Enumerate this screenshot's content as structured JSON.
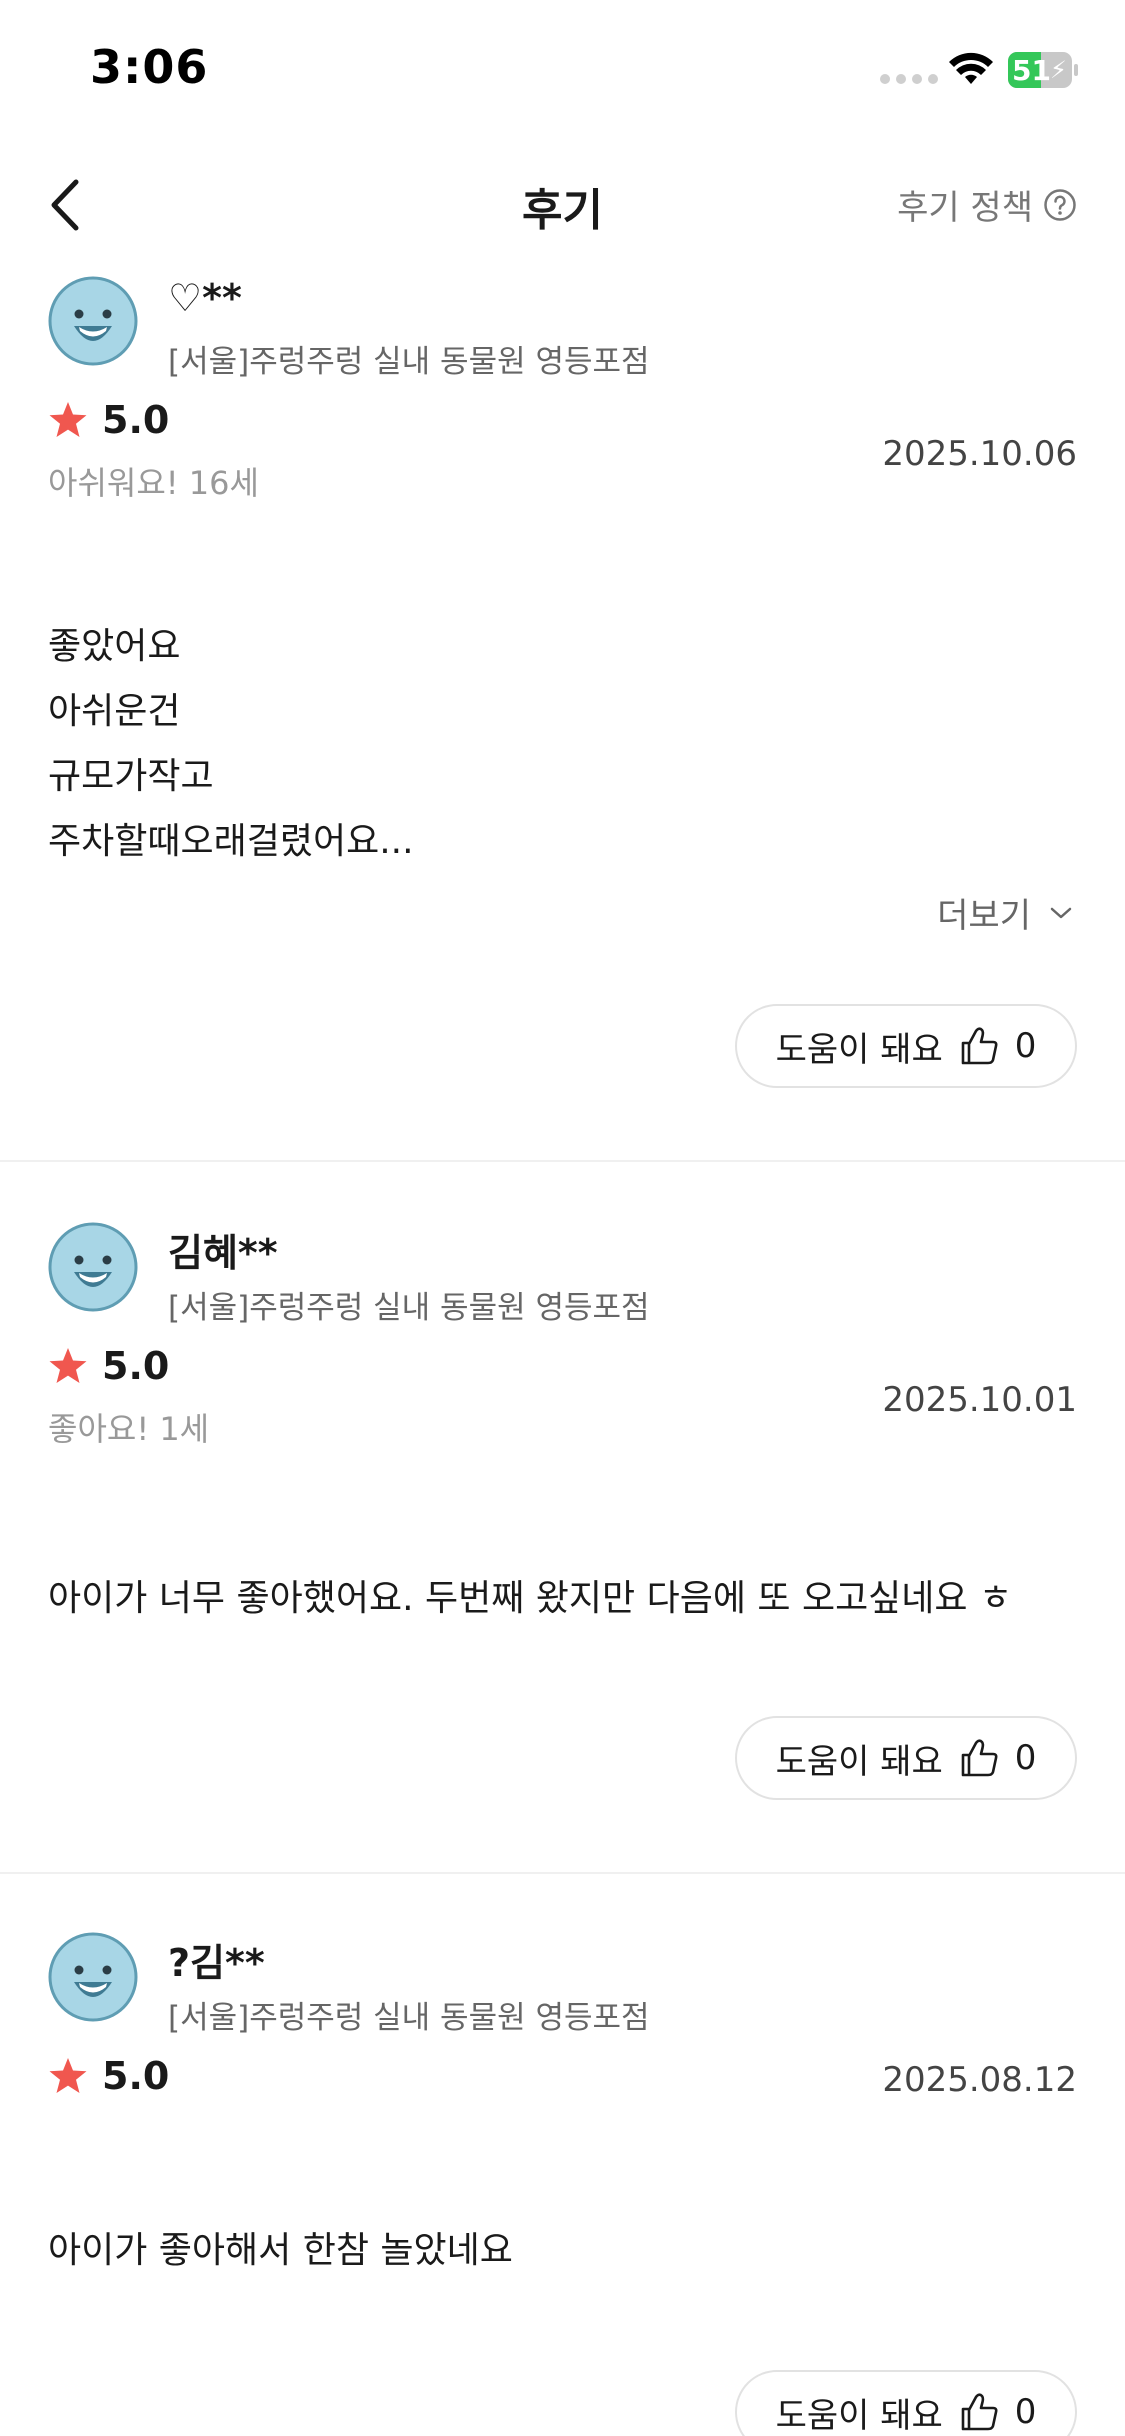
{
  "status_bar": {
    "time": "3:06",
    "battery": "51"
  },
  "nav": {
    "title": "후기",
    "policy_label": "후기 정책"
  },
  "reviews": [
    {
      "name": "♡**",
      "store": "[서울]주렁주렁 실내 동물원 영등포점",
      "rating": "5.0",
      "age_tag": "아쉬워요! 16세",
      "date": "2025.10.06",
      "body_lines": [
        "좋았어요",
        "아쉬운건",
        "규모가작고",
        "주차할때오래걸렸어요..."
      ],
      "more_label": "더보기",
      "helpful_label": "도움이 돼요",
      "helpful_count": "0"
    },
    {
      "name": "김혜**",
      "store": "[서울]주렁주렁 실내 동물원 영등포점",
      "rating": "5.0",
      "age_tag": "좋아요! 1세",
      "date": "2025.10.01",
      "body_lines": [
        "아이가 너무 좋아했어요. 두번째 왔지만 다음에 또 오고싶네요 ㅎ"
      ],
      "helpful_label": "도움이 돼요",
      "helpful_count": "0"
    },
    {
      "name": "?김**",
      "store": "[서울]주렁주렁 실내 동물원 영등포점",
      "rating": "5.0",
      "date": "2025.08.12",
      "body_lines": [
        "아이가 좋아해서 한참 놀았네요"
      ],
      "helpful_label": "도움이 돼요",
      "helpful_count": "0"
    }
  ],
  "icons": {
    "avatar": "smiling-face-avatar-icon",
    "star": "star-icon",
    "thumb": "thumbs-up-icon",
    "back": "chevron-left-icon",
    "help": "question-circle-icon",
    "more": "chevron-down-icon"
  },
  "colors": {
    "star": "#f0574f",
    "avatar_bg": "#a8d6e6",
    "battery_green": "#34c759"
  }
}
